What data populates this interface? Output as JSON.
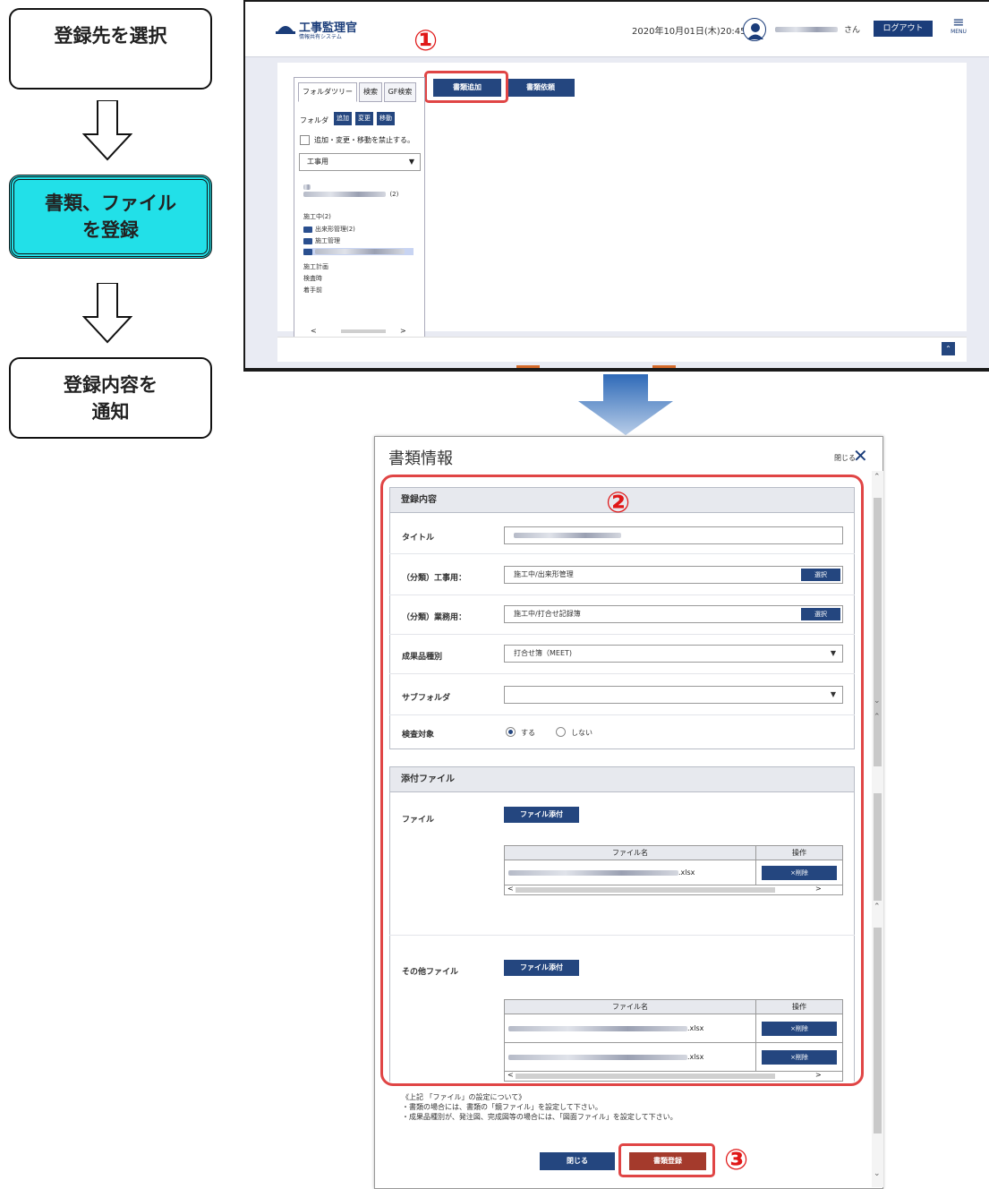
{
  "flow": {
    "step1": "登録先を選択",
    "step2_line1": "書類、ファイル",
    "step2_line2": "を登録",
    "step3_line1": "登録内容を",
    "step3_line2": "通知",
    "active_color": "#22e0e8"
  },
  "top_app": {
    "logo_title": "工事監理官",
    "logo_subtitle": "情報共有システム",
    "datetime": "2020年10月01日(木)20:45",
    "user_suffix": "さん",
    "logout": "ログアウト",
    "menu": "MENU",
    "add_document_button": "書類追加",
    "request_document_button": "書類依頼",
    "callout_1": "①",
    "tabs": [
      "フォルダツリー",
      "検索",
      "GF検索"
    ],
    "folder_label": "フォルダ",
    "folder_buttons": [
      "追加",
      "変更",
      "移動"
    ],
    "prohibit_checkbox_label": "追加・変更・移動を禁止する。",
    "folder_select_value": "工事用",
    "tree": {
      "item_root": "(2)",
      "item_under_construction": "施工中(2)",
      "item_progress_mgmt": "出来形管理(2)",
      "item_construction_mgmt": "施工管理",
      "item_plan": "施工計画",
      "item_inspection": "検査時",
      "item_before_start": "着手前"
    },
    "scroll_left": "<",
    "scroll_right": ">",
    "scroll_top": "⌃"
  },
  "dialog": {
    "title": "書類情報",
    "close_label": "閉じる",
    "callout_2": "②",
    "callout_3": "③",
    "section_registration": "登録内容",
    "label_title": "タイトル",
    "label_class_construction": "（分類）工事用：",
    "value_class_construction": "施工中/出来形管理",
    "label_class_business": "（分類）業務用：",
    "value_class_business": "施工中/打合せ記録簿",
    "select_button": "選択",
    "label_deliverable_type": "成果品種別",
    "value_deliverable_type": "打合せ簿（MEET)",
    "label_subfolder": "サブフォルダ",
    "value_subfolder": "",
    "label_inspection_target": "検査対象",
    "radio_yes": "する",
    "radio_no": "しない",
    "section_attachments": "添付ファイル",
    "label_file": "ファイル",
    "label_other_files": "その他ファイル",
    "attach_button": "ファイル添付",
    "col_filename": "ファイル名",
    "col_operation": "操作",
    "delete_button": "×削除",
    "file_ext": ".xlsx",
    "note_line1": "《上記 「ファイル」の設定について》",
    "note_line2": "・書類の場合には、書類の「鏡ファイル」を設定して下さい。",
    "note_line3": "・成果品種別が、発注図、完成図等の場合には、「図面ファイル」を設定して下さい。",
    "footer_close": "閉じる",
    "footer_register": "書類登録",
    "accent_red": "#e04545",
    "brand_navy": "#24467f"
  }
}
